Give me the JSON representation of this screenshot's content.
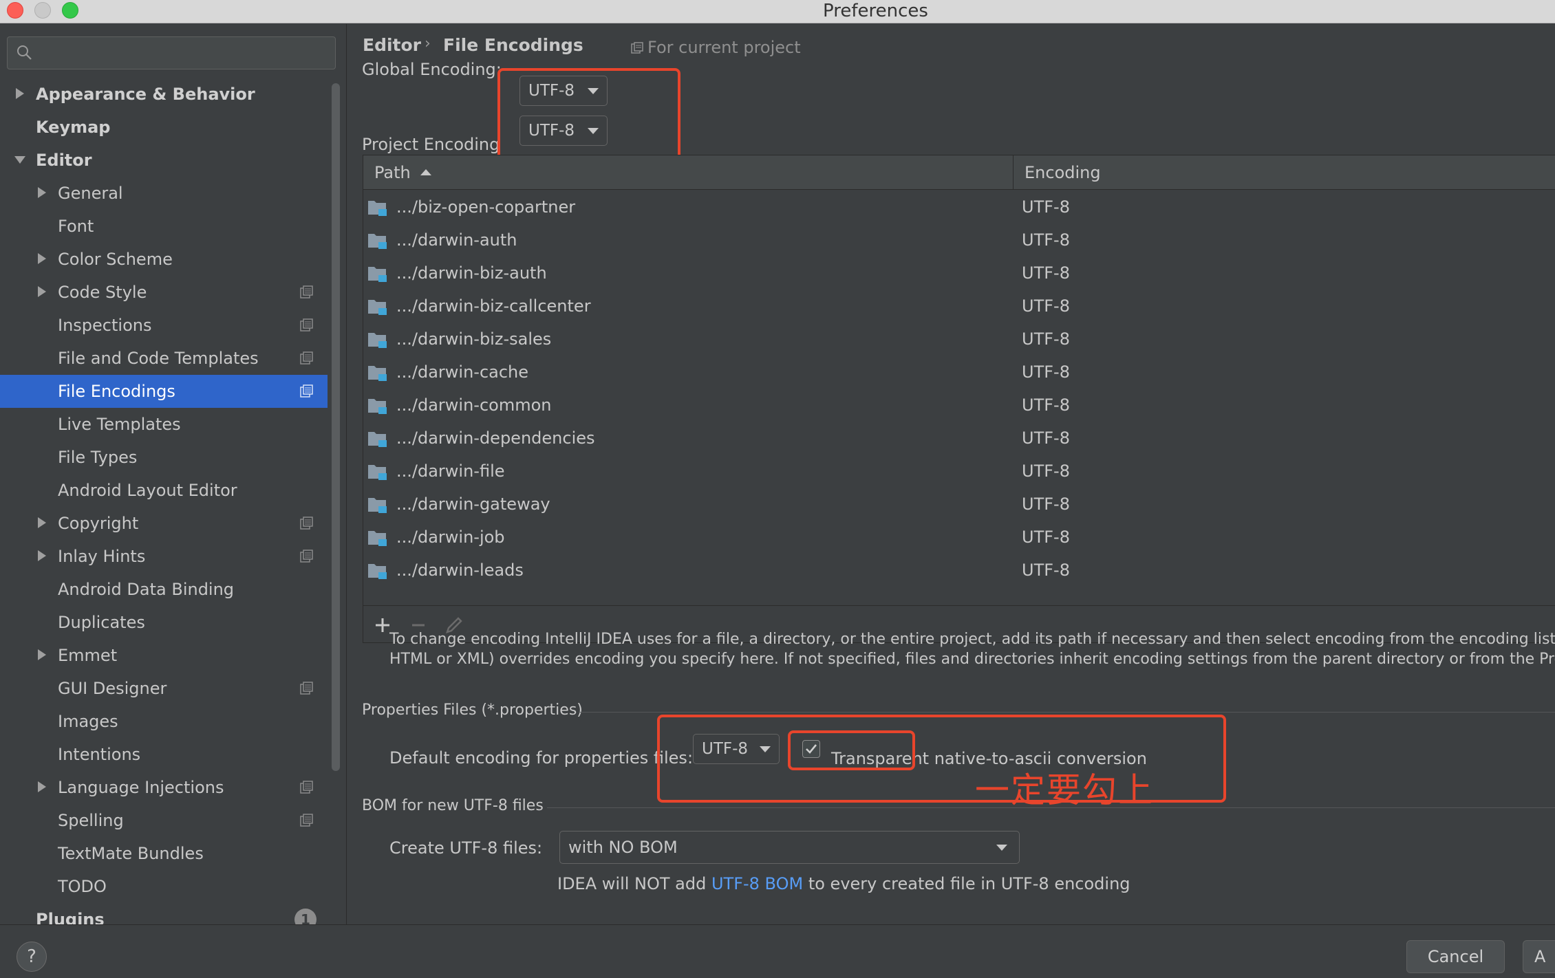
{
  "window": {
    "title": "Preferences"
  },
  "search": {
    "placeholder": ""
  },
  "sidebar": {
    "items": [
      {
        "label": "Appearance & Behavior",
        "level": 0,
        "arrow": "right",
        "bold": true,
        "proj": false
      },
      {
        "label": "Keymap",
        "level": 0,
        "arrow": "none",
        "bold": true,
        "proj": false
      },
      {
        "label": "Editor",
        "level": 0,
        "arrow": "down",
        "bold": true,
        "proj": false
      },
      {
        "label": "General",
        "level": 1,
        "arrow": "right",
        "bold": false,
        "proj": false
      },
      {
        "label": "Font",
        "level": 1,
        "arrow": "none",
        "bold": false,
        "proj": false
      },
      {
        "label": "Color Scheme",
        "level": 1,
        "arrow": "right",
        "bold": false,
        "proj": false
      },
      {
        "label": "Code Style",
        "level": 1,
        "arrow": "right",
        "bold": false,
        "proj": true
      },
      {
        "label": "Inspections",
        "level": 1,
        "arrow": "none",
        "bold": false,
        "proj": true
      },
      {
        "label": "File and Code Templates",
        "level": 1,
        "arrow": "none",
        "bold": false,
        "proj": true
      },
      {
        "label": "File Encodings",
        "level": 1,
        "arrow": "none",
        "bold": false,
        "proj": true,
        "selected": true
      },
      {
        "label": "Live Templates",
        "level": 1,
        "arrow": "none",
        "bold": false,
        "proj": false
      },
      {
        "label": "File Types",
        "level": 1,
        "arrow": "none",
        "bold": false,
        "proj": false
      },
      {
        "label": "Android Layout Editor",
        "level": 1,
        "arrow": "none",
        "bold": false,
        "proj": false
      },
      {
        "label": "Copyright",
        "level": 1,
        "arrow": "right",
        "bold": false,
        "proj": true
      },
      {
        "label": "Inlay Hints",
        "level": 1,
        "arrow": "right",
        "bold": false,
        "proj": true
      },
      {
        "label": "Android Data Binding",
        "level": 1,
        "arrow": "none",
        "bold": false,
        "proj": false
      },
      {
        "label": "Duplicates",
        "level": 1,
        "arrow": "none",
        "bold": false,
        "proj": false
      },
      {
        "label": "Emmet",
        "level": 1,
        "arrow": "right",
        "bold": false,
        "proj": false
      },
      {
        "label": "GUI Designer",
        "level": 1,
        "arrow": "none",
        "bold": false,
        "proj": true
      },
      {
        "label": "Images",
        "level": 1,
        "arrow": "none",
        "bold": false,
        "proj": false
      },
      {
        "label": "Intentions",
        "level": 1,
        "arrow": "none",
        "bold": false,
        "proj": false
      },
      {
        "label": "Language Injections",
        "level": 1,
        "arrow": "right",
        "bold": false,
        "proj": true
      },
      {
        "label": "Spelling",
        "level": 1,
        "arrow": "none",
        "bold": false,
        "proj": true
      },
      {
        "label": "TextMate Bundles",
        "level": 1,
        "arrow": "none",
        "bold": false,
        "proj": false
      },
      {
        "label": "TODO",
        "level": 1,
        "arrow": "none",
        "bold": false,
        "proj": false
      },
      {
        "label": "Plugins",
        "level": 0,
        "arrow": "none",
        "bold": true,
        "proj": false,
        "badge": "1"
      }
    ]
  },
  "breadcrumb": {
    "parent": "Editor",
    "separator": "›",
    "current": "File Encodings"
  },
  "for_current_project": "For current project",
  "global_encoding": {
    "label": "Global Encoding:",
    "value": "UTF-8"
  },
  "project_encoding": {
    "label": "Project Encoding",
    "value": "UTF-8"
  },
  "table": {
    "columns": [
      "Path",
      "Encoding"
    ],
    "rows": [
      {
        "path": ".../biz-open-copartner",
        "encoding": "UTF-8"
      },
      {
        "path": ".../darwin-auth",
        "encoding": "UTF-8"
      },
      {
        "path": ".../darwin-biz-auth",
        "encoding": "UTF-8"
      },
      {
        "path": ".../darwin-biz-callcenter",
        "encoding": "UTF-8"
      },
      {
        "path": ".../darwin-biz-sales",
        "encoding": "UTF-8"
      },
      {
        "path": ".../darwin-cache",
        "encoding": "UTF-8"
      },
      {
        "path": ".../darwin-common",
        "encoding": "UTF-8"
      },
      {
        "path": ".../darwin-dependencies",
        "encoding": "UTF-8"
      },
      {
        "path": ".../darwin-file",
        "encoding": "UTF-8"
      },
      {
        "path": ".../darwin-gateway",
        "encoding": "UTF-8"
      },
      {
        "path": ".../darwin-job",
        "encoding": "UTF-8"
      },
      {
        "path": ".../darwin-leads",
        "encoding": "UTF-8"
      }
    ]
  },
  "help_text": {
    "line1": "To change encoding IntelliJ IDEA uses for a file, a directory, or the entire project, add its path if necessary and then select encoding from the encoding list. Built-in fil",
    "line2": "HTML or XML) overrides encoding you specify here. If not specified, files and directories inherit encoding settings from the parent directory or from the Project Enco"
  },
  "properties": {
    "group_title": "Properties Files (*.properties)",
    "default_label": "Default encoding for properties files:",
    "default_value": "UTF-8",
    "checkbox_label": "Transparent native-to-ascii conversion",
    "checked": true
  },
  "annotation": "一定要勾上",
  "bom": {
    "group_title": "BOM for new UTF-8 files",
    "create_label": "Create UTF-8 files:",
    "create_value": "with NO BOM",
    "note_prefix": "IDEA will NOT add ",
    "note_link": "UTF-8 BOM",
    "note_suffix": " to every created file in UTF-8 encoding"
  },
  "buttons": {
    "help": "?",
    "cancel": "Cancel",
    "apply": "A"
  },
  "colors": {
    "accent": "#2f65ca",
    "annotation": "#e8452c",
    "link": "#589df6",
    "background": "#3c3f41"
  }
}
